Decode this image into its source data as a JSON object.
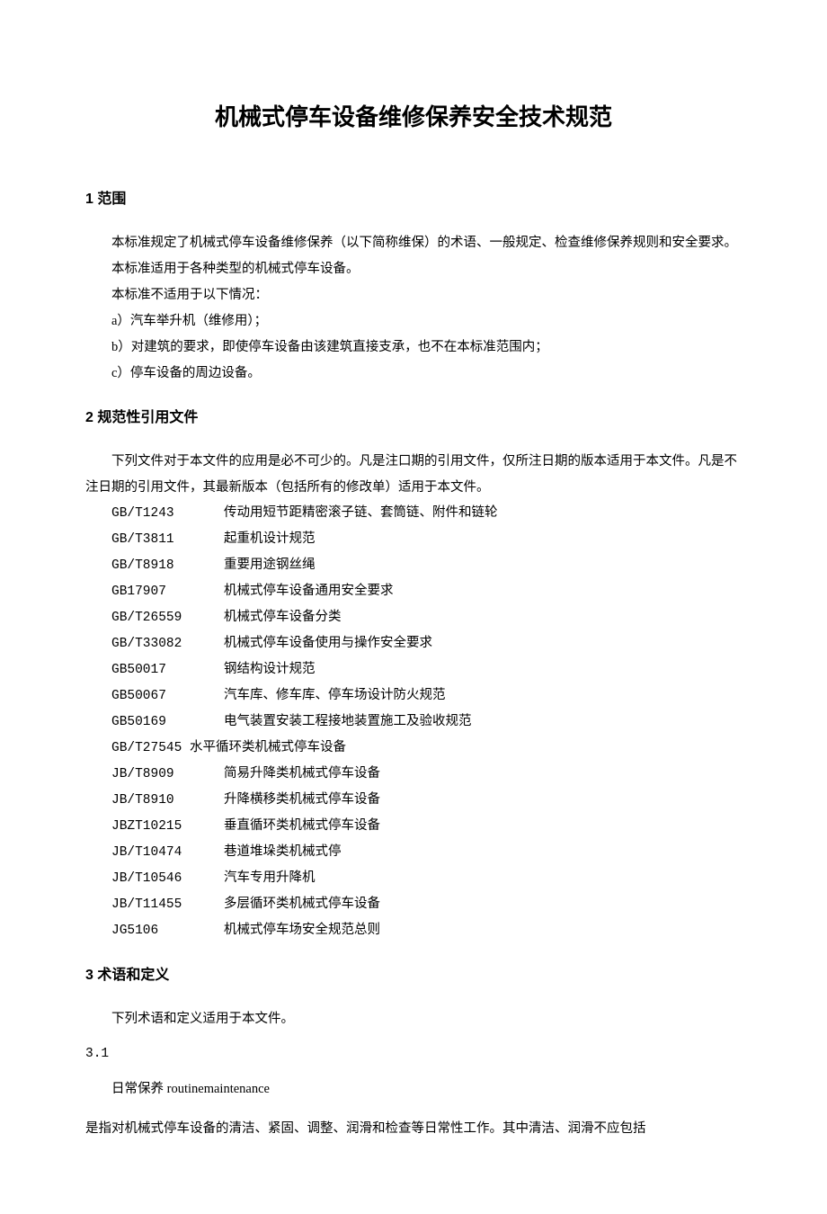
{
  "title": "机械式停车设备维修保养安全技术规范",
  "s1": {
    "heading": "1 范围",
    "p1": "本标准规定了机械式停车设备维修保养（以下简称维保）的术语、一般规定、检查维修保养规则和安全要求。",
    "p2": "本标准适用于各种类型的机械式停车设备。",
    "p3": "本标准不适用于以下情况：",
    "a": "a）汽车举升机（维修用）；",
    "b": "b）对建筑的要求，即使停车设备由该建筑直接支承，也不在本标准范围内；",
    "c": "c）停车设备的周边设备。"
  },
  "s2": {
    "heading": "2 规范性引用文件",
    "intro": "下列文件对于本文件的应用是必不可少的。凡是注口期的引用文件，仅所注日期的版本适用于本文件。凡是不注日期的引用文件，其最新版本（包括所有的修改单）适用于本文件。",
    "refs": [
      {
        "code": "GB/T1243",
        "title": "传动用短节距精密滚子链、套筒链、附件和链轮"
      },
      {
        "code": "GB/T3811",
        "title": "起重机设计规范"
      },
      {
        "code": "GB/T8918",
        "title": "重要用途钢丝绳"
      },
      {
        "code": "GB17907",
        "title": "机械式停车设备通用安全要求"
      },
      {
        "code": "GB/T26559",
        "title": "机械式停车设备分类"
      },
      {
        "code": "GB/T33082",
        "title": "机械式停车设备使用与操作安全要求"
      },
      {
        "code": "GB50017",
        "title": "钢结构设计规范"
      },
      {
        "code": "GB50067",
        "title": "汽车库、修车库、停车场设计防火规范"
      },
      {
        "code": "GB50169",
        "title": "电气装置安装工程接地装置施工及验收规范"
      }
    ],
    "ref_full": "GB/T27545 水平循环类机械式停车设备",
    "refs2": [
      {
        "code": "JB/T8909",
        "title": "简易升降类机械式停车设备"
      },
      {
        "code": "JB/T8910",
        "title": "升降横移类机械式停车设备"
      },
      {
        "code": "JBZT10215",
        "title": "垂直循环类机械式停车设备"
      },
      {
        "code": "JB/T10474",
        "title": "巷道堆垛类机械式停"
      },
      {
        "code": "JB/T10546",
        "title": "汽车专用升降机"
      },
      {
        "code": "JB/T11455",
        "title": "多层循环类机械式停车设备"
      },
      {
        "code": "JG5106",
        "title": "机械式停车场安全规范总则"
      }
    ]
  },
  "s3": {
    "heading": "3 术语和定义",
    "intro": "下列术语和定义适用于本文件。",
    "num31": "3.1",
    "term31": "日常保养 routinemaintenance",
    "def31": "是指对机械式停车设备的清洁、紧固、调整、润滑和检查等日常性工作。其中清洁、润滑不应包括"
  }
}
